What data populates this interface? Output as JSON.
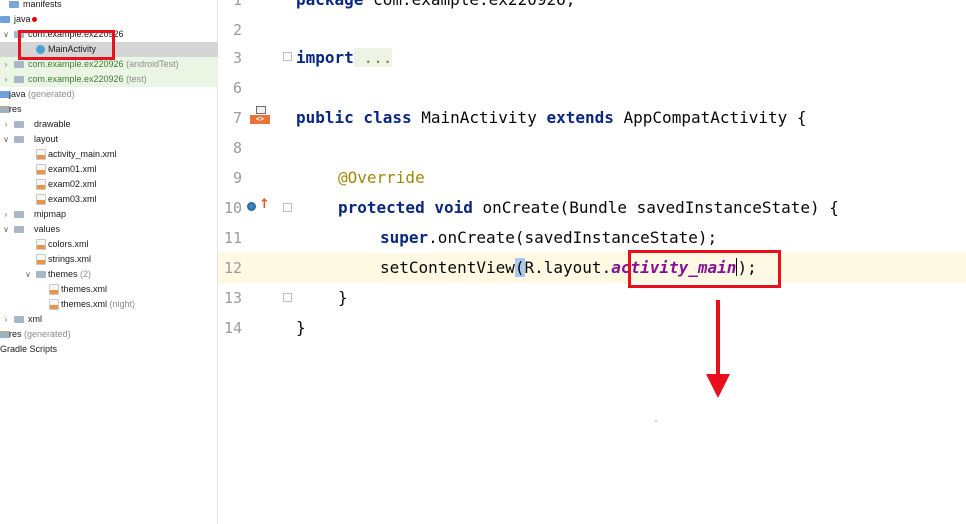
{
  "colors": {
    "annotation_red": "#e8101c",
    "keyword_blue": "#0a2780",
    "field_purple": "#871094",
    "annotation_olive": "#9e880d",
    "current_line": "#fdf9e3"
  },
  "tree": {
    "items": [
      {
        "label": "manifests"
      },
      {
        "label": "java"
      },
      {
        "label": "com.example.ex220926"
      },
      {
        "label": "MainActivity"
      },
      {
        "label": "com.example.ex220926",
        "suffix": "(androidTest)"
      },
      {
        "label": "com.example.ex220926",
        "suffix": "(test)"
      },
      {
        "label": "java",
        "suffix": "(generated)"
      },
      {
        "label": "res"
      },
      {
        "label": "drawable"
      },
      {
        "label": "layout"
      },
      {
        "label": "activity_main.xml"
      },
      {
        "label": "exam01.xml"
      },
      {
        "label": "exam02.xml"
      },
      {
        "label": "exam03.xml"
      },
      {
        "label": "mipmap"
      },
      {
        "label": "values"
      },
      {
        "label": "colors.xml"
      },
      {
        "label": "strings.xml"
      },
      {
        "label": "themes",
        "suffix": "(2)"
      },
      {
        "label": "themes.xml"
      },
      {
        "label": "themes.xml",
        "suffix": "(night)"
      },
      {
        "label": "xml"
      },
      {
        "label": "res",
        "suffix": "(generated)"
      },
      {
        "label": "Gradle Scripts"
      }
    ]
  },
  "editor": {
    "line_numbers": [
      "1",
      "2",
      "3",
      "6",
      "7",
      "8",
      "9",
      "10",
      "11",
      "12",
      "13",
      "14"
    ],
    "code": {
      "l1": {
        "kw": "package",
        "rest": " com.example.ex220926;"
      },
      "l3": {
        "kw": "import",
        "rest": " ..."
      },
      "l7": {
        "kw1": "public class",
        "name": " MainActivity ",
        "kw2": "extends",
        "rest": " AppCompatActivity {"
      },
      "l9": {
        "annotation": "@Override"
      },
      "l10": {
        "kw": "protected void",
        "rest": " onCreate(Bundle savedInstanceState) {"
      },
      "l11": {
        "kw": "super",
        "rest": ".onCreate(savedInstanceState);"
      },
      "l12": {
        "pre": "setContentView",
        "open": "(",
        "mid": "R.layout.",
        "field": "activity_main",
        "close": ")",
        "end": ";"
      },
      "l13": {
        "text": "}"
      },
      "l14": {
        "text": "}"
      }
    },
    "gutter_icons": {
      "implements_icon_text": "<>"
    }
  }
}
